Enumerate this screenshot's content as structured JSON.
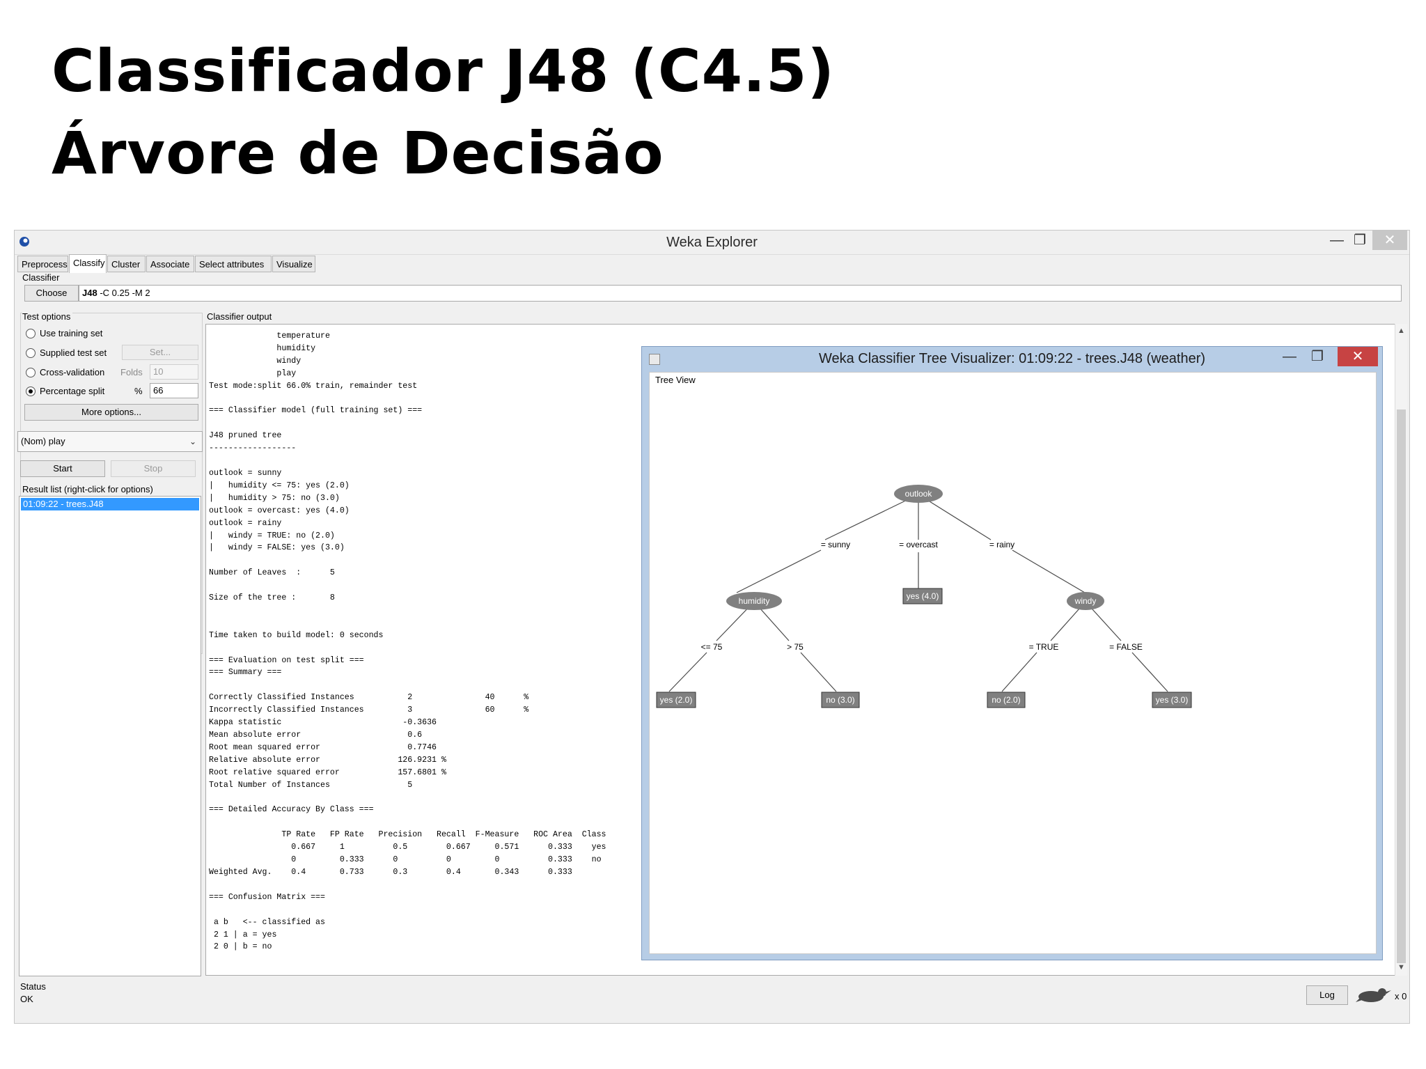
{
  "slide": {
    "title_line1": "Classificador J48 (C4.5)",
    "title_line2": "Árvore de Decisão"
  },
  "explorer": {
    "window_title": "Weka Explorer",
    "controls": {
      "minimize": "—",
      "maximize": "❐",
      "close": "✕"
    },
    "tabs": [
      {
        "label": "Preprocess"
      },
      {
        "label": "Classify"
      },
      {
        "label": "Cluster"
      },
      {
        "label": "Associate"
      },
      {
        "label": "Select attributes"
      },
      {
        "label": "Visualize"
      }
    ],
    "active_tab": "Classify",
    "classifier": {
      "group_label": "Classifier",
      "choose_label": "Choose",
      "name": "J48",
      "options": "-C 0.25 -M 2"
    },
    "test_options": {
      "group_label": "Test options",
      "use_training_set": "Use training set",
      "supplied_test_set": "Supplied test set",
      "set_button": "Set...",
      "cross_validation": "Cross-validation",
      "folds_label": "Folds",
      "folds_value": "10",
      "percentage_split": "Percentage split",
      "percent_label": "%",
      "percent_value": "66",
      "selected": "Percentage split",
      "more_options": "More options..."
    },
    "class_select": {
      "value": "(Nom) play"
    },
    "start_label": "Start",
    "stop_label": "Stop",
    "result_list": {
      "label": "Result list (right-click for options)",
      "items": [
        "01:09:22 - trees.J48"
      ]
    },
    "output": {
      "label": "Classifier output",
      "lines": [
        "              temperature",
        "              humidity",
        "              windy",
        "              play",
        "Test mode:split 66.0% train, remainder test",
        "",
        "=== Classifier model (full training set) ===",
        "",
        "J48 pruned tree",
        "------------------",
        "",
        "outlook = sunny",
        "|   humidity <= 75: yes (2.0)",
        "|   humidity > 75: no (3.0)",
        "outlook = overcast: yes (4.0)",
        "outlook = rainy",
        "|   windy = TRUE: no (2.0)",
        "|   windy = FALSE: yes (3.0)",
        "",
        "Number of Leaves  :      5",
        "",
        "Size of the tree :       8",
        "",
        "",
        "Time taken to build model: 0 seconds",
        "",
        "=== Evaluation on test split ===",
        "=== Summary ===",
        "",
        "Correctly Classified Instances           2               40      %",
        "Incorrectly Classified Instances         3               60      %",
        "Kappa statistic                         -0.3636",
        "Mean absolute error                      0.6",
        "Root mean squared error                  0.7746",
        "Relative absolute error                126.9231 %",
        "Root relative squared error            157.6801 %",
        "Total Number of Instances                5",
        "",
        "=== Detailed Accuracy By Class ===",
        "",
        "               TP Rate   FP Rate   Precision   Recall  F-Measure   ROC Area  Class",
        "                 0.667     1          0.5        0.667     0.571      0.333    yes",
        "                 0         0.333      0          0         0          0.333    no",
        "Weighted Avg.    0.4       0.733      0.3        0.4       0.343      0.333",
        "",
        "=== Confusion Matrix ===",
        "",
        " a b   <-- classified as",
        " 2 1 | a = yes",
        " 2 0 | b = no"
      ]
    },
    "status": {
      "label": "Status",
      "value": "OK"
    },
    "log_label": "Log",
    "tasks_count": "x 0"
  },
  "visualizer": {
    "window_title": "Weka Classifier Tree Visualizer: 01:09:22 - trees.J48 (weather)",
    "controls": {
      "minimize": "—",
      "maximize": "❐",
      "close": "✕"
    },
    "tree_view_label": "Tree View",
    "tree": {
      "root": "outlook",
      "edges": {
        "sunny": "= sunny",
        "overcast": "= overcast",
        "rainy": "= rainy",
        "hum_le": "<= 75",
        "hum_gt": "> 75",
        "win_true": "= TRUE",
        "win_false": "= FALSE"
      },
      "nodes": {
        "humidity": "humidity",
        "windy": "windy"
      },
      "leaves": {
        "overcast": "yes (4.0)",
        "hum_le": "yes (2.0)",
        "hum_gt": "no (3.0)",
        "win_true": "no (2.0)",
        "win_false": "yes (3.0)"
      }
    }
  },
  "colors": {
    "selection": "#3399ff",
    "visualizer_frame": "#b7cde6",
    "close_red": "#c74343",
    "tree_node": "#808080"
  }
}
